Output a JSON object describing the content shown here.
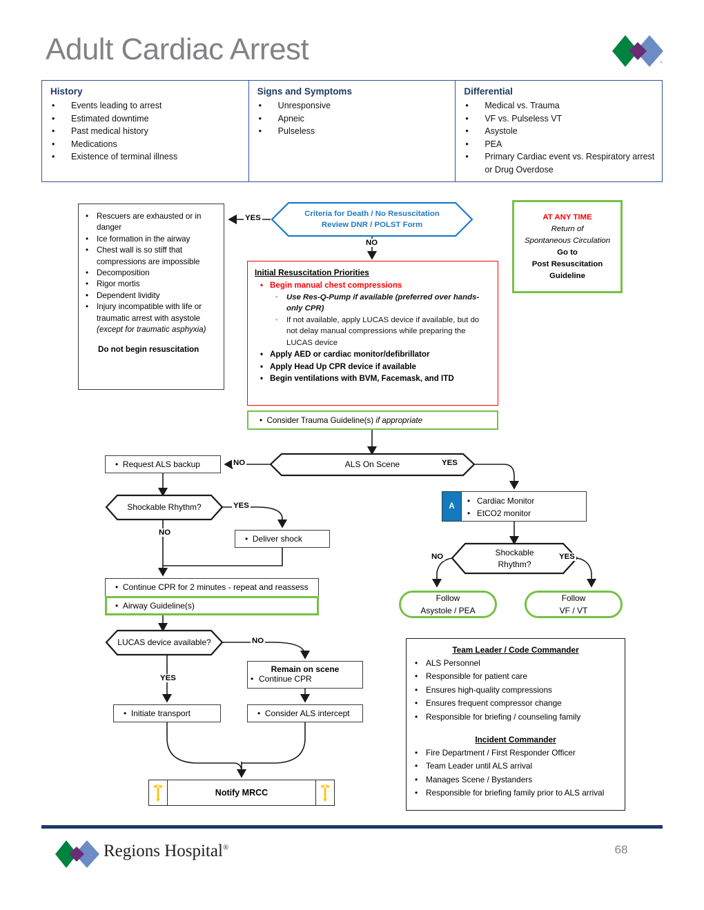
{
  "page_title": "Adult Cardiac Arrest",
  "page_number": "68",
  "brand": {
    "name": "Regions Hospital",
    "trademark": "®"
  },
  "colors": {
    "header_blue": "#1f3864",
    "table_border_blue": "#2f5496",
    "diamond_blue": "#1f7ac4",
    "green": "#76c043",
    "red": "#ff0000",
    "tag_blue": "#1479bd",
    "caduceus_yellow": "#ffc20e",
    "title_gray": "#808285"
  },
  "header_table": {
    "columns": [
      {
        "title": "History",
        "items": [
          "Events leading to arrest",
          "Estimated downtime",
          "Past medical history",
          "Medications",
          "Existence of terminal illness"
        ]
      },
      {
        "title": "Signs and Symptoms",
        "items": [
          "Unresponsive",
          "Apneic",
          "Pulseless"
        ]
      },
      {
        "title": "Differential",
        "items": [
          "Medical vs. Trauma",
          "VF vs. Pulseless VT",
          "Asystole",
          "PEA",
          "Primary Cardiac event vs. Respiratory arrest or Drug Overdose"
        ]
      }
    ]
  },
  "death_criteria": {
    "items": [
      "Rescuers are exhausted or in danger",
      "Ice formation in the airway",
      "Chest wall is so stiff that compressions are impossible",
      "Decomposition",
      "Rigor mortis",
      "Dependent lividity",
      "Injury incompatible with life or traumatic arrest with asystole"
    ],
    "italic_note": "(except for traumatic asphyxia)",
    "footnote": "Do not begin resuscitation"
  },
  "criteria_decision": {
    "line1": "Criteria for Death / No Resuscitation",
    "line2": "Review DNR / POLST Form",
    "yes_label": "YES",
    "no_label": "NO"
  },
  "any_time_box": {
    "heading": "AT ANY TIME",
    "italic_line1": "Return of",
    "italic_line2": "Spontaneous Circulation",
    "bold_line1": "Go to",
    "bold_line2": "Post Resuscitation",
    "bold_line3": "Guideline"
  },
  "resuscitation_box": {
    "title": "Initial Resuscitation Priorities",
    "primary_red": "Begin manual chest compressions",
    "sub_bold_italic": "Use Res-Q-Pump if available (preferred over hands-only CPR)",
    "sub_plain": "If not available, apply LUCAS device if available, but do not delay manual compressions while preparing the LUCAS device",
    "bullets": [
      "Apply AED or cardiac monitor/defibrillator",
      "Apply Head Up CPR device if available",
      "Begin ventilations with BVM, Facemask, and ITD"
    ]
  },
  "trauma_box": {
    "text_plain": "Consider Trauma Guideline(s) ",
    "text_italic": "if appropriate"
  },
  "als_on_scene": {
    "label": "ALS On Scene",
    "no_label": "NO",
    "yes_label": "YES"
  },
  "request_als": {
    "text": "Request ALS backup"
  },
  "shockable_left": {
    "label": "Shockable Rhythm?",
    "yes_label": "YES",
    "no_label": "NO"
  },
  "deliver_shock": {
    "text": "Deliver shock"
  },
  "continue_cpr": {
    "text": "Continue CPR for 2 minutes - repeat and reassess"
  },
  "airway_guideline": {
    "text": "Airway Guideline(s)"
  },
  "lucas_decision": {
    "label": "LUCAS device available?",
    "yes_label": "YES",
    "no_label": "NO"
  },
  "initiate_transport": {
    "text": "Initiate transport"
  },
  "remain_on_scene": {
    "title": "Remain on scene",
    "item": "Continue CPR"
  },
  "consider_intercept": {
    "text": "Consider ALS intercept"
  },
  "notify_mrcc": {
    "text": "Notify MRCC",
    "icon_left": "caduceus-icon",
    "icon_right": "caduceus-icon"
  },
  "monitor_box": {
    "tag": "A",
    "items": [
      "Cardiac Monitor",
      "EtCO2 monitor"
    ]
  },
  "shockable_right": {
    "line1": "Shockable",
    "line2": "Rhythm?",
    "no_label": "NO",
    "yes_label": "YES"
  },
  "follow_asystole": {
    "line1": "Follow",
    "line2": "Asystole / PEA"
  },
  "follow_vfvt": {
    "line1": "Follow",
    "line2": "VF / VT"
  },
  "team_panel": {
    "section1_title": "Team Leader / Code Commander",
    "section1_items": [
      "ALS Personnel",
      "Responsible for patient care",
      "Ensures high-quality compressions",
      "Ensures frequent compressor change",
      "Responsible for briefing / counseling family"
    ],
    "section2_title": "Incident Commander",
    "section2_items": [
      "Fire Department / First Responder Officer",
      "Team Leader until ALS arrival",
      "Manages Scene / Bystanders",
      "Responsible for briefing family prior to ALS arrival"
    ]
  }
}
